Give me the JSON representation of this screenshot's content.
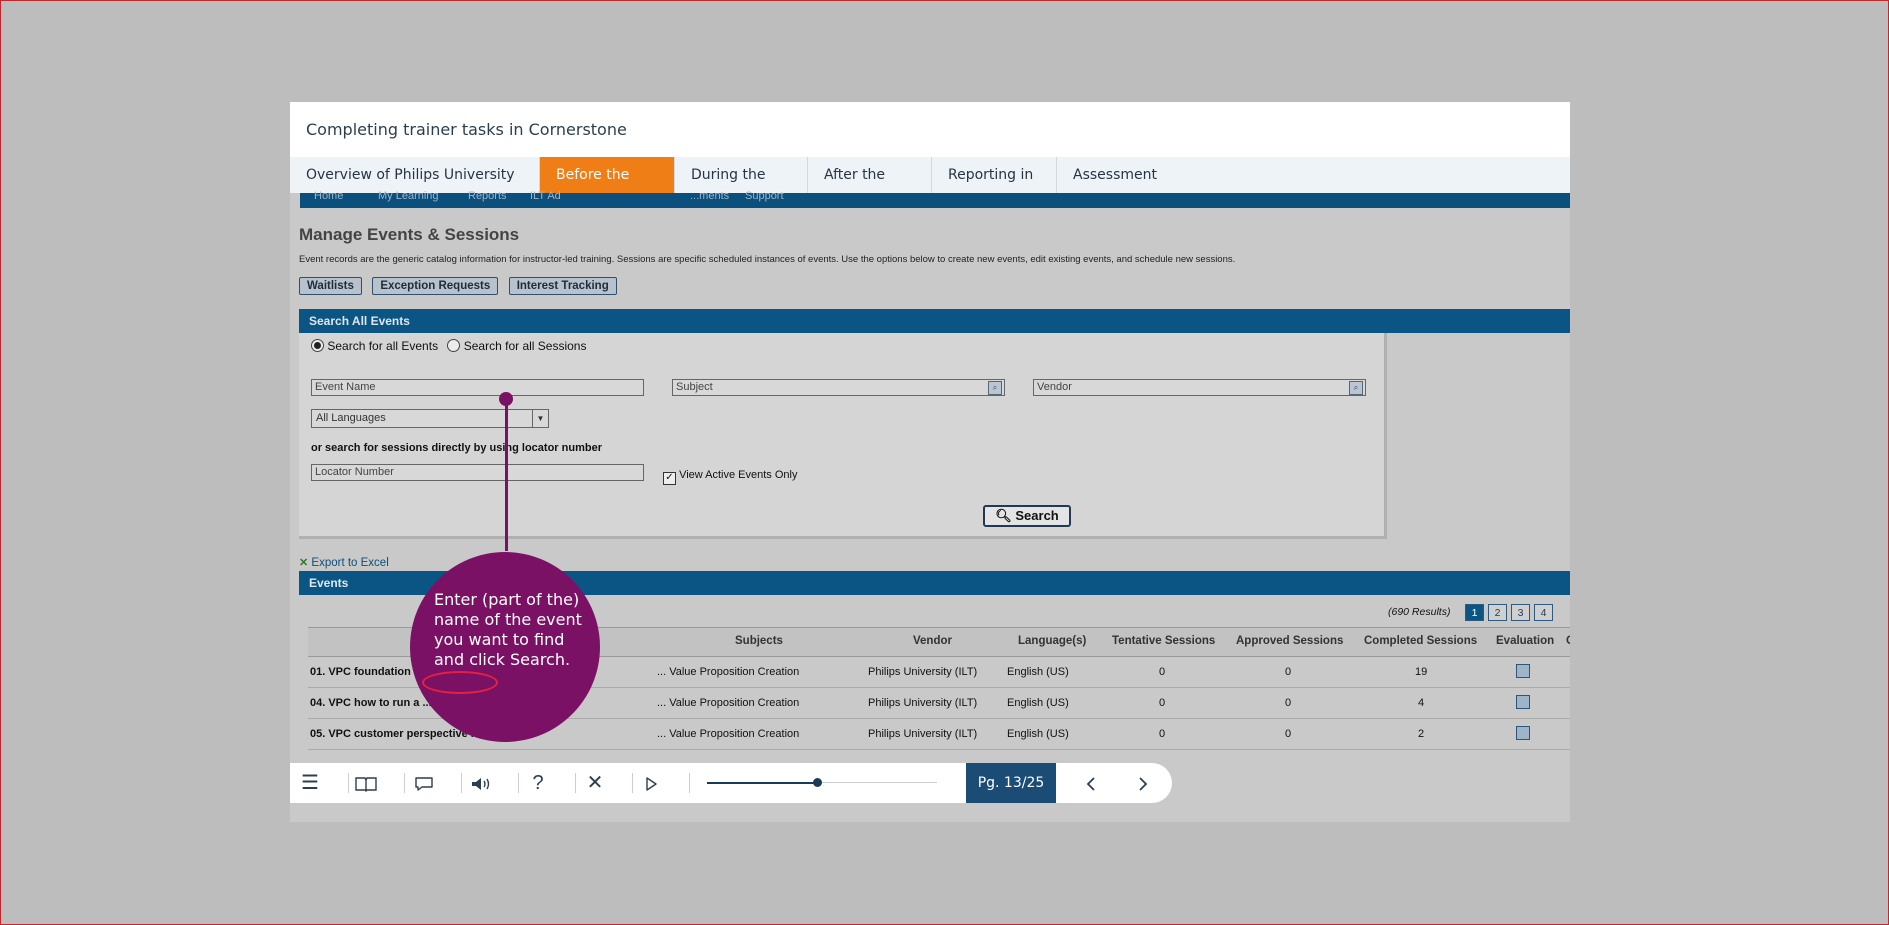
{
  "course": {
    "title": "Completing trainer tasks in Cornerstone",
    "nav": [
      {
        "label": "Overview of Philips University and LMS",
        "active": false
      },
      {
        "label": "Before the training",
        "active": true
      },
      {
        "label": "During the training",
        "active": false
      },
      {
        "label": "After the training",
        "active": false
      },
      {
        "label": "Reporting in LMS",
        "active": false
      },
      {
        "label": "Assessment",
        "active": false
      }
    ]
  },
  "app": {
    "menubar": [
      "Home",
      "My Learning",
      "Reports",
      "ILT Ad",
      "...ments",
      "Support"
    ],
    "page_title": "Manage Events & Sessions",
    "description": "Event records are the generic catalog information for instructor-led training. Sessions are specific scheduled instances of events. Use the options below to create new events, edit existing events, and schedule new sessions.",
    "buttons": {
      "waitlists": "Waitlists",
      "exception_requests": "Exception Requests",
      "interest_tracking": "Interest Tracking"
    },
    "search_section": "Search All Events",
    "radio_events": "Search for all Events",
    "radio_sessions": "Search for all Sessions",
    "event_name_placeholder": "Event Name",
    "subject_placeholder": "Subject",
    "vendor_placeholder": "Vendor",
    "language_selected": "All Languages",
    "locator_label": "or search for sessions directly by using locator number",
    "locator_placeholder": "Locator Number",
    "active_only_label": "View Active Events Only",
    "search_button": "Search",
    "export_label": "Export to Excel",
    "events_section": "Events",
    "results_count": "(690 Results)",
    "pages": [
      "1",
      "2",
      "3",
      "4"
    ],
    "columns": [
      "Subjects",
      "Vendor",
      "Language(s)",
      "Tentative Sessions",
      "Approved Sessions",
      "Completed Sessions",
      "Evaluation",
      "C"
    ],
    "rows": [
      {
        "name": "01. VPC foundation",
        "subject": "... Value Proposition Creation",
        "vendor": "Philips University (ILT)",
        "language": "English (US)",
        "tentative": "0",
        "approved": "0",
        "completed": "19"
      },
      {
        "name": "04. VPC how to run a ...",
        "subject": "... Value Proposition Creation",
        "vendor": "Philips University (ILT)",
        "language": "English (US)",
        "tentative": "0",
        "approved": "0",
        "completed": "4"
      },
      {
        "name": "05. VPC customer perspective ... insight",
        "subject": "... Value Proposition Creation",
        "vendor": "Philips University (ILT)",
        "language": "English (US)",
        "tentative": "0",
        "approved": "0",
        "completed": "2"
      }
    ]
  },
  "callout": {
    "text": "Enter (part of the) name of the event you want to find and click Search."
  },
  "player": {
    "page_indicator": "Pg. 13/25",
    "progress_fraction": 0.48,
    "icons": [
      "menu-icon",
      "book-icon",
      "chat-icon",
      "volume-icon",
      "help-icon",
      "close-icon",
      "play-icon",
      "prev-icon",
      "next-icon"
    ]
  },
  "colors": {
    "accent": "#f07e16",
    "callout": "#7b1165",
    "brand_blue": "#0b5584",
    "player_dark": "#1a4c76"
  }
}
